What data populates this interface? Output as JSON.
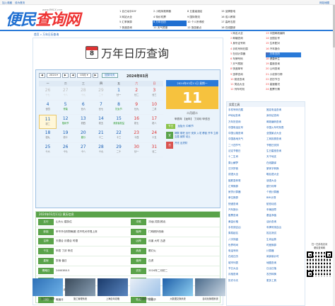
{
  "topbar": {
    "links": [
      "加入收藏",
      "设为首页"
    ],
    "right_link": "网站地图"
  },
  "logo": {
    "brand_a": "便民",
    "brand_b": "查询网",
    "url": "www.BMCX.com"
  },
  "header_nav": [
    [
      "1 自己动手DIY",
      "2 小程序推荐器",
      "8 五星级酒店",
      "15 品牌厨电"
    ],
    [
      "3 网站大全",
      "4 特价机票",
      "9 国际物流",
      "16 成人教育"
    ],
    [
      "5 汇率换算",
      "6 万年日历",
      "10 个人所得税",
      "17 高考志愿"
    ],
    [
      "7 快递查询",
      "11 天气预报",
      "12 旅游景点",
      "18 在线翻译"
    ]
  ],
  "breadcrumb": "首页 » 万年日历查询",
  "page_title": "万年日历查询",
  "title_icon_num": "8",
  "calendar": {
    "prev_year": "◀",
    "year": "2024 ▾",
    "next_year": "▶",
    "prev_month": "◀",
    "month": "03月 ▾",
    "next_month": "▶",
    "today_btn": "回到今天",
    "heading": "2024年03月",
    "weekdays": [
      "一",
      "二",
      "三",
      "四",
      "五",
      "六",
      "日"
    ],
    "days": [
      {
        "d": "26",
        "l": "十七",
        "other": true
      },
      {
        "d": "27",
        "l": "十八",
        "other": true
      },
      {
        "d": "28",
        "l": "十九",
        "other": true
      },
      {
        "d": "29",
        "l": "二十",
        "other": true
      },
      {
        "d": "1",
        "l": "廿一"
      },
      {
        "d": "2",
        "l": "廿二",
        "we": true
      },
      {
        "d": "3",
        "l": "廿三",
        "we": true
      },
      {
        "d": "4",
        "l": "廿四"
      },
      {
        "d": "5",
        "l": "惊蛰",
        "hol": true
      },
      {
        "d": "6",
        "l": "廿六"
      },
      {
        "d": "7",
        "l": "廿七"
      },
      {
        "d": "8",
        "l": "妇女节",
        "hol": true
      },
      {
        "d": "9",
        "l": "廿九",
        "we": true
      },
      {
        "d": "10",
        "l": "二月",
        "we": true
      },
      {
        "d": "11",
        "l": "初二",
        "sel": true
      },
      {
        "d": "12",
        "l": "植树节",
        "hol": true
      },
      {
        "d": "13",
        "l": "初四"
      },
      {
        "d": "14",
        "l": "初五"
      },
      {
        "d": "15",
        "l": "消费者权益",
        "hol": true
      },
      {
        "d": "16",
        "l": "初七",
        "we": true
      },
      {
        "d": "17",
        "l": "初八",
        "we": true
      },
      {
        "d": "18",
        "l": "初九"
      },
      {
        "d": "19",
        "l": "初十"
      },
      {
        "d": "20",
        "l": "春分",
        "hol": true
      },
      {
        "d": "21",
        "l": "十二"
      },
      {
        "d": "22",
        "l": "十三"
      },
      {
        "d": "23",
        "l": "十四",
        "we": true
      },
      {
        "d": "24",
        "l": "十五",
        "we": true
      },
      {
        "d": "25",
        "l": "十六"
      },
      {
        "d": "26",
        "l": "十七"
      },
      {
        "d": "27",
        "l": "十八"
      },
      {
        "d": "28",
        "l": "十九"
      },
      {
        "d": "29",
        "l": "二十"
      },
      {
        "d": "30",
        "l": "廿一",
        "we": true
      },
      {
        "d": "31",
        "l": "廿二",
        "we": true
      }
    ]
  },
  "day_card": {
    "head": "2024年03月11日 星期一",
    "big": "11",
    "lunar": "二月初二",
    "ganzhi": "甲辰年 【龙年】 丁卯月 甲戌日",
    "jieqi_label": "节日",
    "jieqi_value": "龙抬头 中和节",
    "yi_label": "宜",
    "yi_value": "嫁娶 祭祀 出行 安床 入宅 移徙 开市 立券 交易 纳财 动土",
    "ji_label": "忌",
    "ji_value": "开光 出货财"
  },
  "huangli": {
    "head": "2024年03月11日 黄历信息",
    "rows": [
      {
        "k": "五行",
        "v": "山头火 建执位"
      },
      {
        "k": "冲煞",
        "v": "冲龙(戊辰)煞北"
      },
      {
        "k": "彭祖",
        "v": "甲不开仓财物耗散 戌不吃犬作怪上床"
      },
      {
        "k": "胎神",
        "v": "门鸡栖外西南"
      },
      {
        "k": "吉神",
        "v": "天德合 月德合 时德"
      },
      {
        "k": "凶神",
        "v": "月害 大时 五虚"
      },
      {
        "k": "干支",
        "v": "甲辰 丁卯 甲戌"
      },
      {
        "k": "纳音",
        "v": "覆灯火"
      },
      {
        "k": "星宿",
        "v": "张宿 值日"
      },
      {
        "k": "值神",
        "v": "白虎"
      },
      {
        "k": "儒略日",
        "v": "2460380.5"
      },
      {
        "k": "农历",
        "v": "2024年二月初二"
      },
      {
        "k": "季节",
        "v": "春季"
      },
      {
        "k": "九星",
        "v": "四绿木星"
      },
      {
        "k": "方位",
        "v": "喜神东北 福神东南"
      },
      {
        "k": "十二神",
        "v": "执日"
      },
      {
        "k": "月相",
        "v": "蛾眉月"
      },
      {
        "k": "物候",
        "v": "桃始华"
      }
    ]
  },
  "thumbs": [
    {
      "cap": "旅游日历推荐"
    },
    {
      "cap": "施工管理系统"
    },
    {
      "cap": "上海自驾攻略"
    },
    {
      "cap": "大数据统计分析"
    },
    {
      "cap": "大数据交换系统"
    },
    {
      "cap": "自动化管理系统"
    }
  ],
  "side_list": [
    {
      "n": "1",
      "t": "网名大全"
    },
    {
      "n": "13",
      "t": "中国邮政编码"
    },
    {
      "n": "2",
      "t": "邮编查询"
    },
    {
      "n": "14",
      "t": "全国区号"
    },
    {
      "n": "3",
      "t": "身份证号码"
    },
    {
      "n": "15",
      "t": "生肖配对"
    },
    {
      "n": "4",
      "t": "手机号码归属"
    },
    {
      "n": "16",
      "t": "汽车报价"
    },
    {
      "n": "5",
      "t": "在线计算器"
    },
    {
      "n": "17",
      "t": "万年日历",
      "hl": true
    },
    {
      "n": "6",
      "t": "车牌号码"
    },
    {
      "n": "18",
      "t": "健康养生"
    },
    {
      "n": "7",
      "t": "天气预报"
    },
    {
      "n": "19",
      "t": "星座查询"
    },
    {
      "n": "8",
      "t": "快递单号"
    },
    {
      "n": "20",
      "t": "公司查询"
    },
    {
      "n": "9",
      "t": "违章查询"
    },
    {
      "n": "21",
      "t": "小说排行榜"
    },
    {
      "n": "10",
      "t": "航班查询"
    },
    {
      "n": "22",
      "t": "农历节日"
    },
    {
      "n": "11",
      "t": "笑话大全"
    },
    {
      "n": "23",
      "t": "高速路况"
    },
    {
      "n": "12",
      "t": "列车时刻"
    },
    {
      "n": "24",
      "t": "股票行情"
    }
  ],
  "tools": {
    "head": "实用工具",
    "items": [
      "手机号码归属",
      "固定电话查询",
      "IP地址查询",
      "身份证查询",
      "万年历查询",
      "邮政编码查询",
      "中国电话区号",
      "中国火车时刻表",
      "中国公路查询",
      "全国景点大全",
      "中国各地天气",
      "工商执照查询",
      "二十四节气",
      "节假日安排",
      "法定节假日",
      "生日星座查询",
      "十二生肖",
      "天干地支",
      "周公解梦",
      "在线翻译",
      "汉字拼音",
      "繁体字转换",
      "成语大全",
      "歇后语大全",
      "脑筋急转弯",
      "谜语大全",
      "汇率换算",
      "银行利率",
      "房贷计算器",
      "个税计算器",
      "单位换算",
      "BMI计算",
      "快递查询",
      "航班动态",
      "汽车报价",
      "车辆违章",
      "股票查询",
      "基金净值",
      "黄金价格",
      "油价查询",
      "手机测吉凶",
      "车牌号测吉凶",
      "周易起名",
      "姓名测试",
      "八字排盘",
      "生肖运势",
      "世界时间",
      "时差换算",
      "电话号码",
      "计算器",
      "在线日历",
      "闹钟倒计时",
      "城市列表",
      "地图查询",
      "节日大全",
      "日出日落",
      "月相查询",
      "农历转换",
      "历史今天",
      "更多工具"
    ]
  },
  "qr": {
    "caption_a": "扫一扫手机访问",
    "caption_b": "便民查询网"
  }
}
